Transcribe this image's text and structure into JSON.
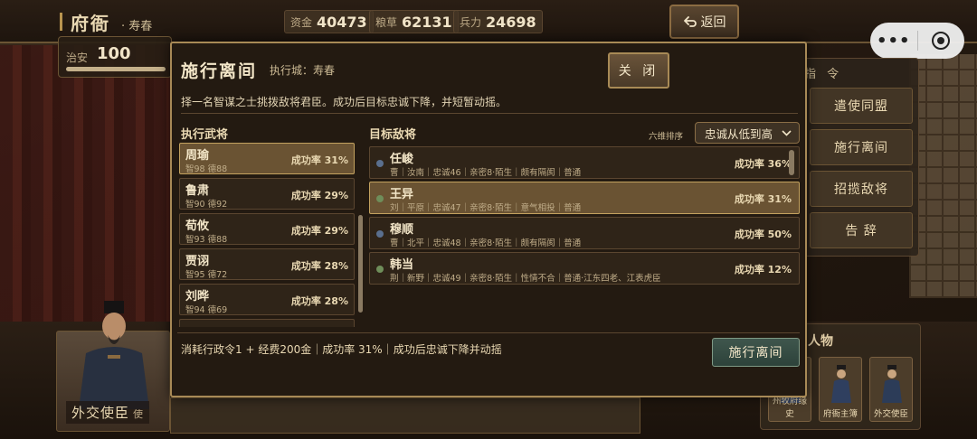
{
  "topbar": {
    "office": "府衙",
    "city": "寿春",
    "resources": [
      {
        "label": "资金",
        "value": "40473"
      },
      {
        "label": "粮草",
        "value": "62131"
      },
      {
        "label": "兵力",
        "value": "24698"
      }
    ],
    "back_label": "返回"
  },
  "order": {
    "label": "治安",
    "value": "100",
    "level": 1.0
  },
  "command_panel": {
    "heading": "指 令",
    "buttons": [
      "遣使同盟",
      "施行离间",
      "招揽敌将",
      "告 辞"
    ]
  },
  "characters": {
    "heading": "人物",
    "cards": [
      "州牧府缘史",
      "府衙主簿",
      "外交使臣"
    ]
  },
  "envoy": {
    "title": "外交使臣",
    "suffix": "使"
  },
  "modal": {
    "title": "施行离间",
    "exec_city": "执行城：寿春",
    "close_label": "关 闭",
    "description": "择一名智谋之士挑拨敌将君臣。成功后目标忠诚下降，并短暂动摇。",
    "generals_label": "执行武将",
    "targets_label": "目标敌将",
    "sort_label": "六维排序",
    "sort_value": "忠诚从低到高",
    "generals": [
      {
        "name": "周瑜",
        "stats": "智98 德88",
        "rate": "成功率 31%"
      },
      {
        "name": "鲁肃",
        "stats": "智90 德92",
        "rate": "成功率 29%"
      },
      {
        "name": "荀攸",
        "stats": "智93 德88",
        "rate": "成功率 29%"
      },
      {
        "name": "贾诩",
        "stats": "智95 德72",
        "rate": "成功率 28%"
      },
      {
        "name": "刘晔",
        "stats": "智94 德69",
        "rate": "成功率 28%"
      },
      {
        "name": "",
        "stats": "",
        "rate": ""
      }
    ],
    "targets": [
      {
        "name": "任峻",
        "info": "曹｜汝南｜忠诚46｜亲密8·陌生｜颇有隔阂｜普通",
        "rate": "成功率 36%",
        "dot": "#5a6f8e"
      },
      {
        "name": "王异",
        "info": "刘｜平原｜忠诚47｜亲密8·陌生｜意气相投｜普通",
        "rate": "成功率 31%",
        "dot": "#6f8e5a"
      },
      {
        "name": "穆顺",
        "info": "曹｜北平｜忠诚48｜亲密8·陌生｜颇有隔阂｜普通",
        "rate": "成功率 50%",
        "dot": "#5a6f8e"
      },
      {
        "name": "韩当",
        "info": "荆｜新野｜忠诚49｜亲密8·陌生｜性情不合｜普通·江东四老、江表虎臣",
        "rate": "成功率 12%",
        "dot": "#6f8e5a"
      }
    ],
    "footer": "消耗行政令1 + 经费200金｜成功率 31%｜成功后忠诚下降并动摇",
    "execute_label": "施行离间"
  }
}
